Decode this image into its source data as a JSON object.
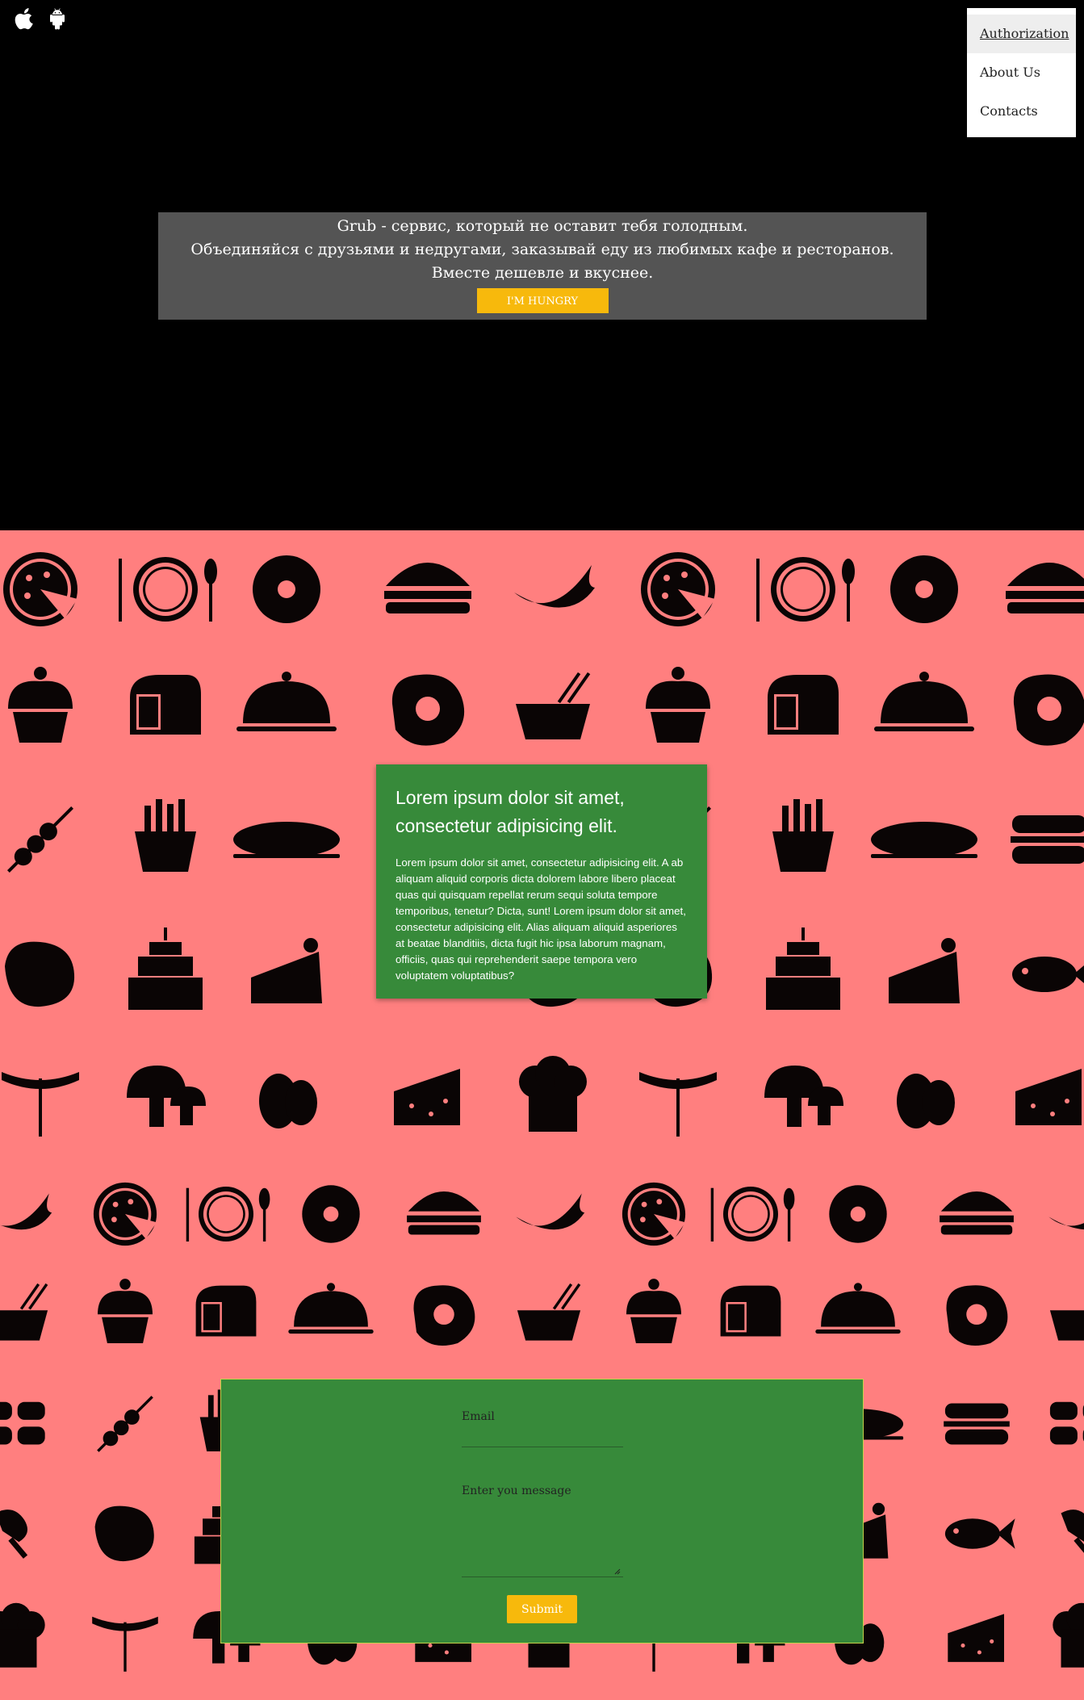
{
  "header": {
    "platform_icons": [
      "apple-icon",
      "android-icon"
    ],
    "nav": [
      {
        "label": "Authorization",
        "active": true
      },
      {
        "label": "About Us",
        "active": false
      },
      {
        "label": "Contacts",
        "active": false
      }
    ]
  },
  "promo": {
    "lines": [
      "Grub - сервис, который не оставит тебя голодным.",
      "Объединяйся с друзьями и недругами, заказывай еду из любимых кафе и ресторанов.",
      "Вместе дешевле и вкуснее."
    ],
    "button_label": "I'M HUNGRY"
  },
  "info_card": {
    "title": "Lorem ipsum dolor sit amet, consectetur adipisicing elit.",
    "body": "Lorem ipsum dolor sit amet, consectetur adipisicing elit. A ab aliquam aliquid corporis dicta dolorem labore libero placeat quas qui quisquam repellat rerum sequi soluta tempore temporibus, tenetur? Dicta, sunt! Lorem ipsum dolor sit amet, consectetur adipisicing elit. Alias aliquam aliquid asperiores at beatae blanditiis, dicta fugit hic ipsa laborum magnam, officiis, quas qui reprehenderit saepe tempora vero voluptatem voluptatibus?"
  },
  "contact_form": {
    "email_label": "Email",
    "email_value": "",
    "message_label": "Enter you message",
    "message_value": "",
    "submit_label": "Submit"
  },
  "colors": {
    "hero_background": "#000000",
    "page_background": "#ff7f7f",
    "promo_background": "#545454",
    "card_green": "#378a3a",
    "accent_yellow": "#f7b90c",
    "food_icons": "#000000"
  },
  "background_pattern": {
    "icons": [
      "pizza-icon",
      "plate-cutlery-icon",
      "donut-icon",
      "burger-icon",
      "croissant-icon",
      "cupcake-icon",
      "bread-icon",
      "cloche-icon",
      "fried-egg-icon",
      "noodle-bowl-icon",
      "kebab-icon",
      "fries-icon",
      "baguette-icon",
      "sandwich-icon",
      "steak-icon",
      "birthday-cake-icon",
      "cake-slice-icon",
      "fish-icon",
      "sausage-fork-icon",
      "mushroom-icon",
      "eggs-icon",
      "cheese-icon",
      "chef-hat-icon",
      "sushi-icon",
      "drumstick-icon"
    ]
  }
}
